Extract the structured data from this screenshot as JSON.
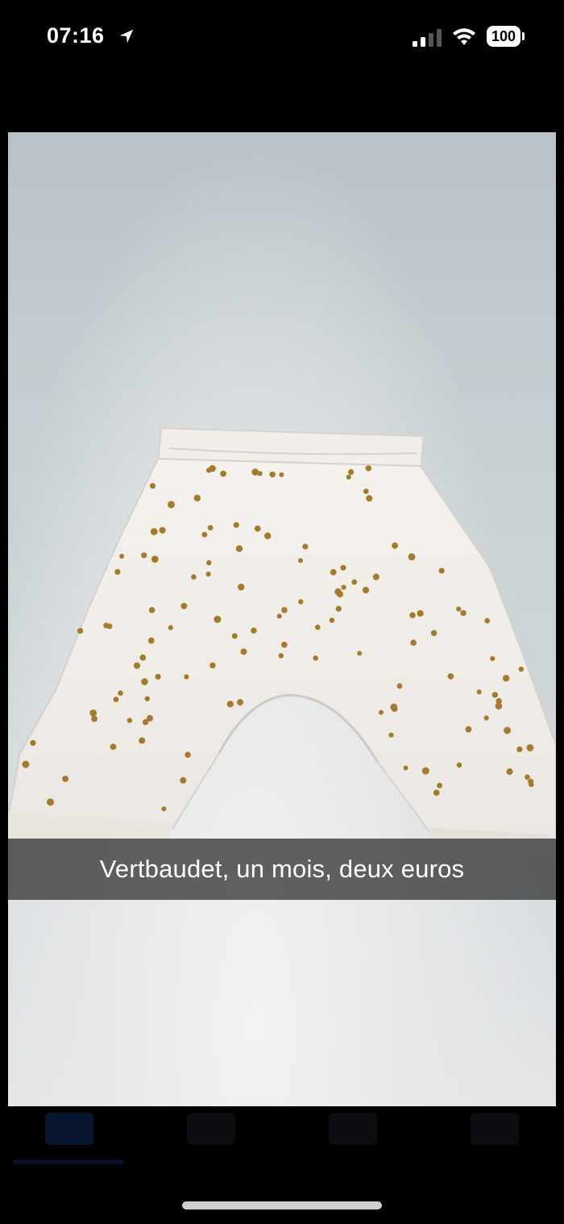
{
  "status_bar": {
    "time": "07:16",
    "battery": "100",
    "icons": [
      "location-arrow-icon",
      "cellular-signal-icon",
      "wifi-icon",
      "battery-icon"
    ]
  },
  "photo": {
    "caption": "Vertbaudet, un mois, deux euros"
  },
  "tab_bar": {
    "icons": [
      "photo-tab-icon",
      "list-tab-icon",
      "bag-tab-icon",
      "search-tab-icon"
    ]
  },
  "colors": {
    "background": "#000000",
    "caption_bar": "#282828",
    "pants_fabric": "#f1ede7",
    "dot_color": "#a47a2c"
  }
}
